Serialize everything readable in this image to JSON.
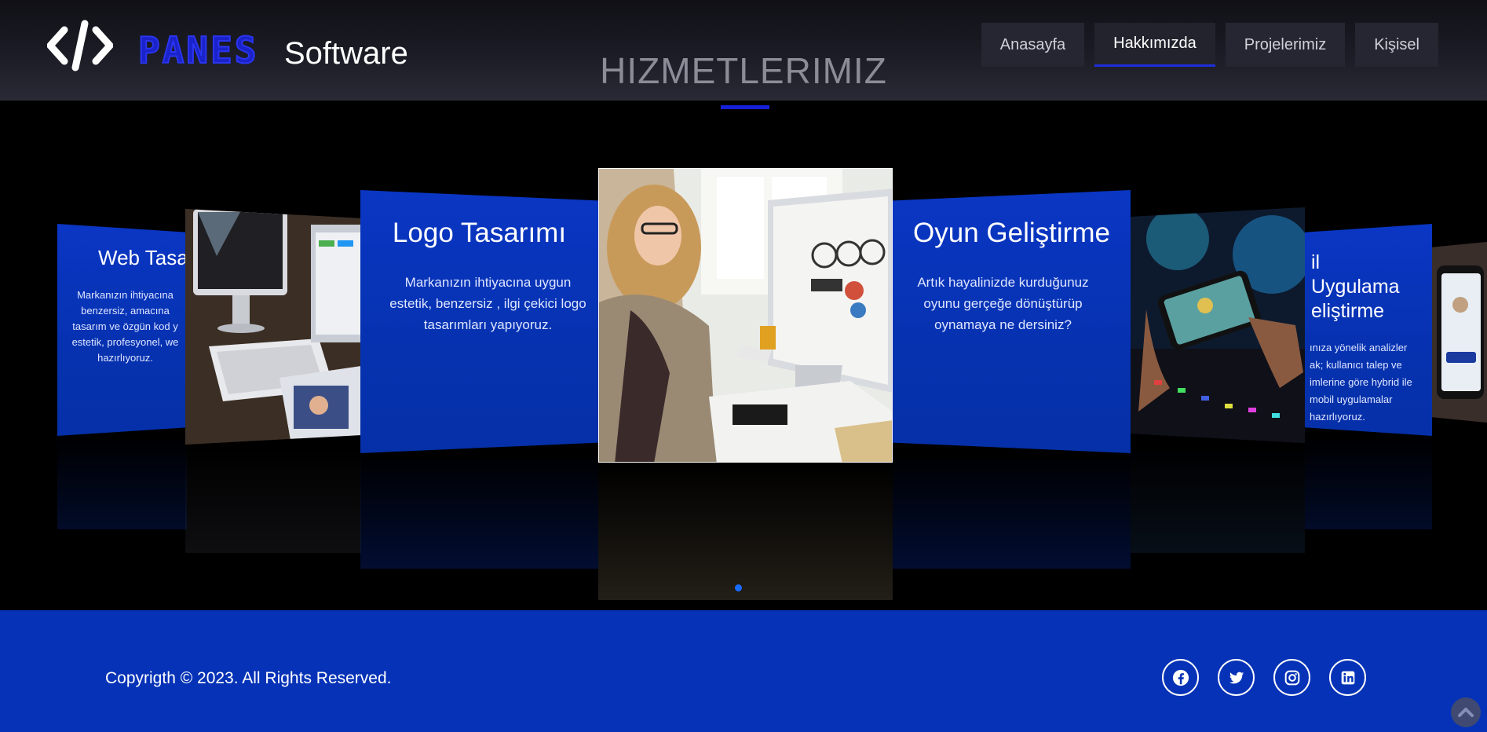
{
  "header": {
    "logo_icon": "code-brackets-icon",
    "brand_name": "PANES",
    "brand_sub": "Software",
    "nav": [
      {
        "label": "Anasayfa",
        "active": false
      },
      {
        "label": "Hakkımızda",
        "active": true
      },
      {
        "label": "Projelerimiz",
        "active": false
      },
      {
        "label": "Kişisel",
        "active": false
      }
    ]
  },
  "section": {
    "title": "HIZMETLERIMIZ"
  },
  "carousel": {
    "cards": [
      {
        "title": "Web Tasar",
        "text": "Markanızın ihtiyacına benzersiz, amacına tasarım ve özgün kod y estetik, profesyonel, we hazırlıyoruz."
      },
      {
        "title": "Logo Tasarımı",
        "text": "Markanızın ihtiyacına uygun estetik, benzersiz , ilgi çekici logo tasarımları yapıyoruz."
      },
      {
        "title": "Oyun Geliştirme",
        "text": "Artık hayalinizde kurduğunuz oyunu gerçeğe dönüştürüp oynamaya ne dersiniz?"
      },
      {
        "title": "il Uygulama eliştirme",
        "text": "ınıza yönelik analizler ak; kullanıcı talep ve imlerine göre hybrid ile mobil uygulamalar hazırlıyoruz."
      }
    ],
    "image_slides": [
      "laptop-desk-photo",
      "woman-designer-photo",
      "mobile-game-photo",
      "phone-hand-photo"
    ],
    "active_dot": 1
  },
  "footer": {
    "copyright": "Copyrigth © 2023. All Rights Reserved.",
    "social": [
      "facebook-icon",
      "twitter-icon",
      "instagram-icon",
      "linkedin-icon"
    ],
    "to_top": "arrow-up-icon"
  },
  "colors": {
    "accent": "#1620d6",
    "footer": "#0532b6",
    "card": "#0a36c4"
  }
}
